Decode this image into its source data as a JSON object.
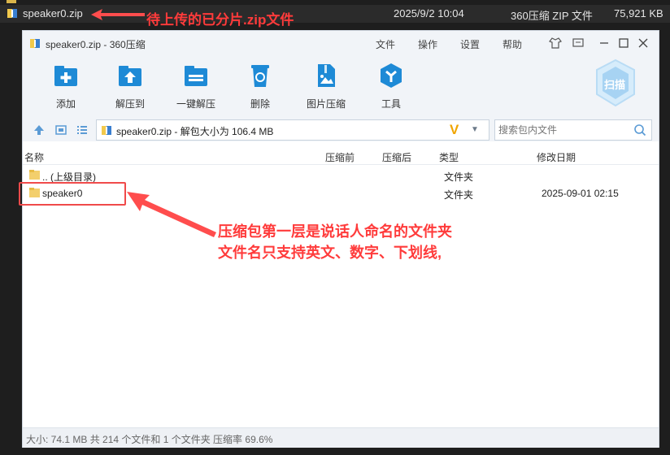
{
  "explorer": {
    "row": {
      "name": "speaker0.zip",
      "date": "2025/9/2 10:04",
      "type": "360压缩 ZIP 文件",
      "size": "75,921 KB"
    }
  },
  "annotations": {
    "top": "待上传的已分片.zip文件",
    "middle_line1": "压缩包第一层是说话人命名的文件夹",
    "middle_line2": "文件名只支持英文、数字、下划线,"
  },
  "window": {
    "title": "speaker0.zip - 360压缩",
    "menu": [
      "文件",
      "操作",
      "设置",
      "帮助"
    ]
  },
  "toolbar": {
    "items": [
      {
        "label": "添加",
        "icon": "add-icon"
      },
      {
        "label": "解压到",
        "icon": "extract-to-icon"
      },
      {
        "label": "一键解压",
        "icon": "one-click-extract-icon"
      },
      {
        "label": "删除",
        "icon": "delete-icon"
      },
      {
        "label": "图片压缩",
        "icon": "image-compress-icon"
      },
      {
        "label": "工具",
        "icon": "tools-icon"
      }
    ],
    "scan_label": "扫描"
  },
  "address": {
    "path": "speaker0.zip - 解包大小为 106.4 MB",
    "search_placeholder": "搜索包内文件"
  },
  "columns": [
    "名称",
    "压缩前",
    "压缩后",
    "类型",
    "修改日期"
  ],
  "rows": [
    {
      "name": ".. (上级目录)",
      "type": "文件夹",
      "date": ""
    },
    {
      "name": "speaker0",
      "type": "文件夹",
      "date": "2025-09-01 02:15"
    }
  ],
  "status": "大小: 74.1 MB 共 214 个文件和 1 个文件夹 压缩率 69.6%",
  "colors": {
    "accent": "#1e8ad6",
    "annotation": "#ff3b3b"
  }
}
